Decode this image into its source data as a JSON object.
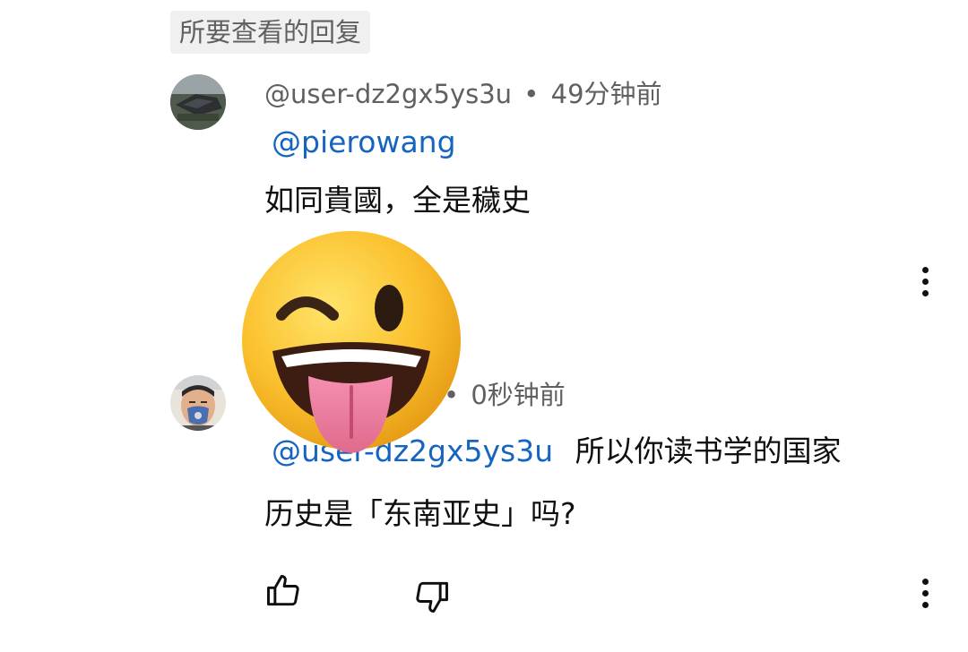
{
  "filter_chip": {
    "label": "所要查看的回复"
  },
  "comments": [
    {
      "author": "@user-dz2gx5ys3u",
      "separator": "•",
      "time": "49分钟前",
      "mention": "@pierowang",
      "text": "如同貴國，全是穢史"
    },
    {
      "separator": "•",
      "time": "0秒钟前",
      "mention": "@user-dz2gx5ys3u",
      "text_line1": "所以你读书学的国家",
      "text_line2": "历史是「东南亚史」吗?"
    }
  ],
  "icons": {
    "more": "more-vert-icon",
    "like": "thumbs-up-icon",
    "dislike": "thumbs-down-icon",
    "sticker": "winking-tongue-emoji"
  },
  "colors": {
    "mention": "#1565c0",
    "meta": "#606060",
    "text": "#0f0f0f",
    "chip_bg": "#f0f0f0"
  }
}
